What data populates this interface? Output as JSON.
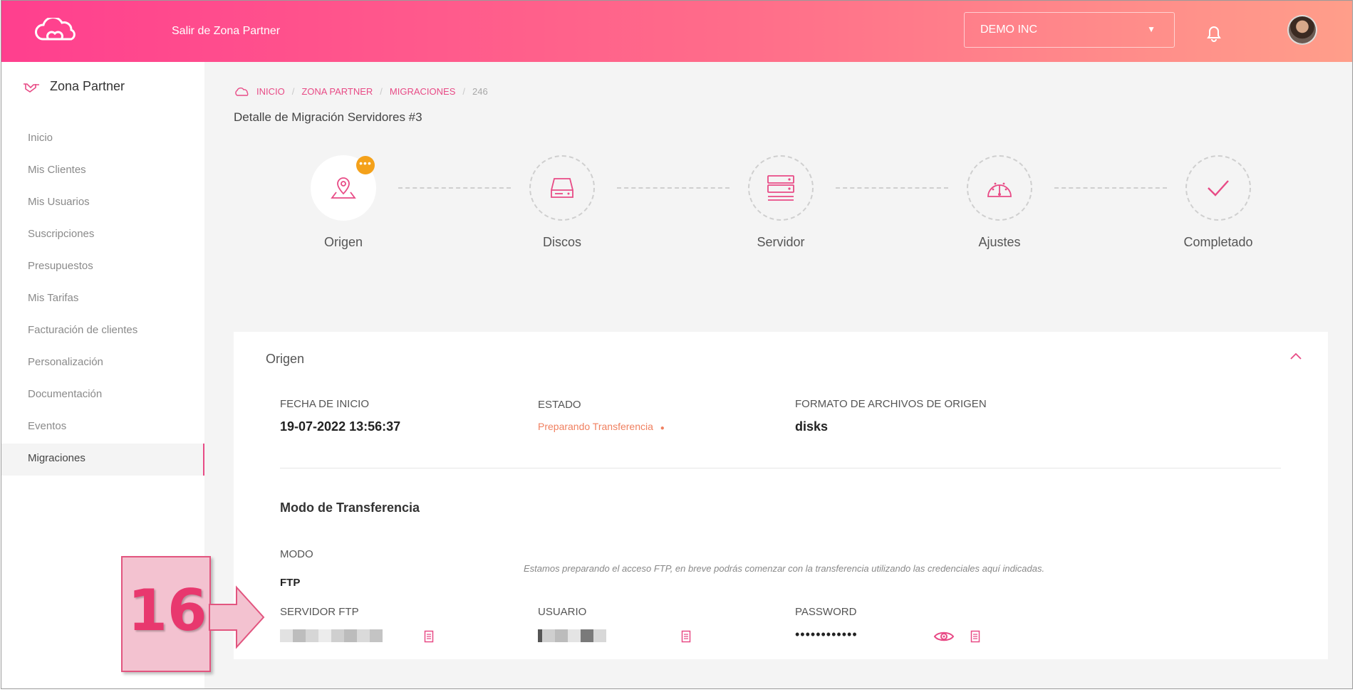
{
  "topbar": {
    "exit_label": "Salir de Zona Partner",
    "company": "DEMO INC"
  },
  "sidebar": {
    "brand": "Zona Partner",
    "items": [
      {
        "label": "Inicio"
      },
      {
        "label": "Mis Clientes"
      },
      {
        "label": "Mis Usuarios"
      },
      {
        "label": "Suscripciones"
      },
      {
        "label": "Presupuestos"
      },
      {
        "label": "Mis Tarifas"
      },
      {
        "label": "Facturación de clientes"
      },
      {
        "label": "Personalización"
      },
      {
        "label": "Documentación"
      },
      {
        "label": "Eventos"
      },
      {
        "label": "Migraciones"
      }
    ],
    "active": "Migraciones"
  },
  "breadcrumb": {
    "items": [
      "INICIO",
      "ZONA PARTNER",
      "MIGRACIONES"
    ],
    "current": "246"
  },
  "page": {
    "title": "Detalle de Migración Servidores #3"
  },
  "steps": [
    {
      "label": "Origen",
      "state": "active",
      "badge": "•••"
    },
    {
      "label": "Discos",
      "state": "pending"
    },
    {
      "label": "Servidor",
      "state": "pending"
    },
    {
      "label": "Ajustes",
      "state": "pending"
    },
    {
      "label": "Completado",
      "state": "pending"
    }
  ],
  "card": {
    "title": "Origen",
    "start_label": "FECHA DE INICIO",
    "start_value": "19-07-2022 13:56:37",
    "status_label": "ESTADO",
    "status_value": "Preparando Transferencia",
    "format_label": "FORMATO DE ARCHIVOS DE ORIGEN",
    "format_value": "disks",
    "transfer_title": "Modo de Transferencia",
    "mode_label": "MODO",
    "mode_value": "FTP",
    "ftp_note": "Estamos preparando el acceso FTP, en breve podrás comenzar con la transferencia utilizando las credenciales aquí indicadas.",
    "server_label": "SERVIDOR FTP",
    "user_label": "USUARIO",
    "password_label": "PASSWORD",
    "password_value": "••••••••••••"
  },
  "annotation": {
    "number": "16"
  },
  "colors": {
    "accent": "#e84b86",
    "status": "#f08060",
    "badge": "#f4a11a"
  }
}
